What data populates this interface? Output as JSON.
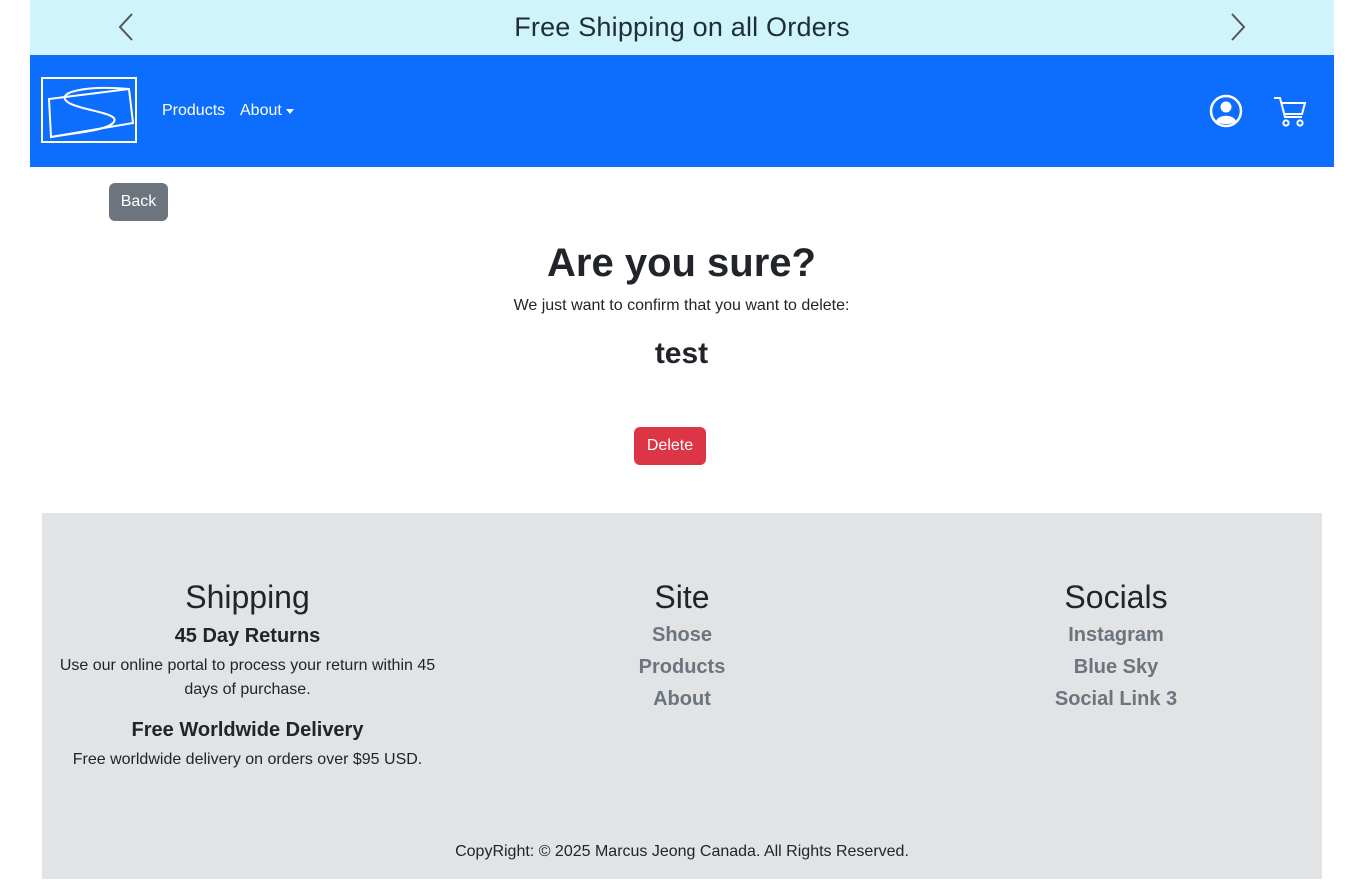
{
  "announcement": {
    "text": "Free Shipping on all Orders"
  },
  "nav": {
    "products_label": "Products",
    "about_label": "About"
  },
  "buttons": {
    "back_label": "Back",
    "delete_label": "Delete"
  },
  "confirm": {
    "title": "Are you sure?",
    "message": "We just want to confirm that you want to delete:",
    "item_name": "test"
  },
  "footer": {
    "shipping": {
      "title": "Shipping",
      "returns_title": "45 Day Returns",
      "returns_text": "Use our online portal to process your return within 45 days of purchase.",
      "delivery_title": "Free Worldwide Delivery",
      "delivery_text": "Free worldwide delivery on orders over $95 USD."
    },
    "site": {
      "title": "Site",
      "links": [
        "Shose",
        "Products",
        "About"
      ]
    },
    "socials": {
      "title": "Socials",
      "links": [
        "Instagram",
        "Blue Sky",
        "Social Link 3"
      ]
    },
    "copyright": "CopyRight: © 2025 Marcus Jeong Canada. All Rights Reserved."
  },
  "colors": {
    "announcement_bg": "#cff4fc",
    "navbar_bg": "#0d6efd",
    "back_button": "#6c757d",
    "delete_button": "#dc3545",
    "footer_bg": "#e1e3e5",
    "footer_link": "#6c757d"
  },
  "icons": {
    "prev": "chevron-left-icon",
    "next": "chevron-right-icon",
    "logo": "brand-logo",
    "account": "user-circle-icon",
    "cart": "cart-icon"
  }
}
